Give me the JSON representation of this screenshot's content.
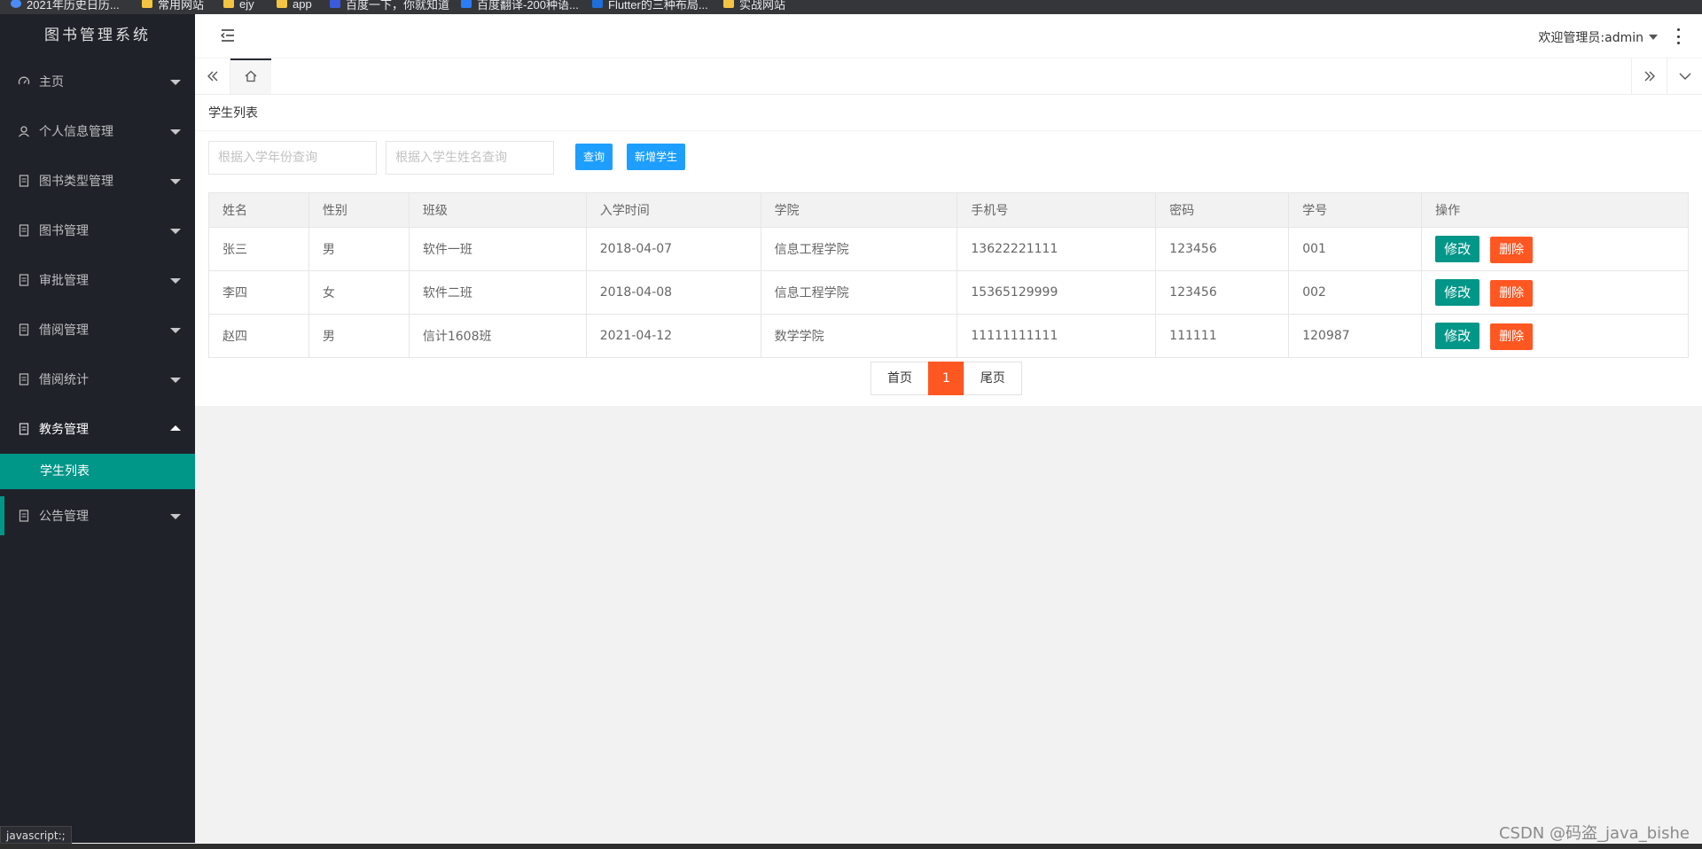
{
  "bookmarks": [
    "2021年历史日历...",
    "常用网站",
    "ejy",
    "app",
    "百度一下，你就知道",
    "百度翻译-200种语...",
    "Flutter的三种布局...",
    "实战网站"
  ],
  "sidebar": {
    "logo": "图书管理系统",
    "items": [
      {
        "label": "主页",
        "icon": "dashboard-icon"
      },
      {
        "label": "个人信息管理",
        "icon": "user-icon"
      },
      {
        "label": "图书类型管理",
        "icon": "file-icon"
      },
      {
        "label": "图书管理",
        "icon": "file-icon"
      },
      {
        "label": "审批管理",
        "icon": "file-icon"
      },
      {
        "label": "借阅管理",
        "icon": "file-icon"
      },
      {
        "label": "借阅统计",
        "icon": "file-icon"
      },
      {
        "label": "教务管理",
        "icon": "file-icon"
      },
      {
        "label": "公告管理",
        "icon": "file-icon"
      }
    ],
    "sub_item": "学生列表",
    "status_text": "javascript:;"
  },
  "header": {
    "welcome": "欢迎管理员:admin"
  },
  "card": {
    "title": "学生列表"
  },
  "search": {
    "year_placeholder": "根据入学年份查询",
    "name_placeholder": "根据入学生姓名查询",
    "query_label": "查询",
    "add_label": "新增学生"
  },
  "table": {
    "headers": [
      "姓名",
      "性别",
      "班级",
      "入学时间",
      "学院",
      "手机号",
      "密码",
      "学号",
      "操作"
    ],
    "rows": [
      [
        "张三",
        "男",
        "软件一班",
        "2018-04-07",
        "信息工程学院",
        "13622221111",
        "123456",
        "001"
      ],
      [
        "李四",
        "女",
        "软件二班",
        "2018-04-08",
        "信息工程学院",
        "15365129999",
        "123456",
        "002"
      ],
      [
        "赵四",
        "男",
        "信计1608班",
        "2021-04-12",
        "数学学院",
        "11111111111",
        "111111",
        "120987"
      ]
    ],
    "edit_label": "修改",
    "delete_label": "删除"
  },
  "pager": {
    "first": "首页",
    "current": "1",
    "last": "尾页"
  },
  "watermark": "CSDN @码盗_java_bishe",
  "colors": {
    "side_bg": "#20222a",
    "accent_green": "#009688",
    "accent_orange": "#ff5722",
    "accent_blue": "#1e9fff"
  }
}
